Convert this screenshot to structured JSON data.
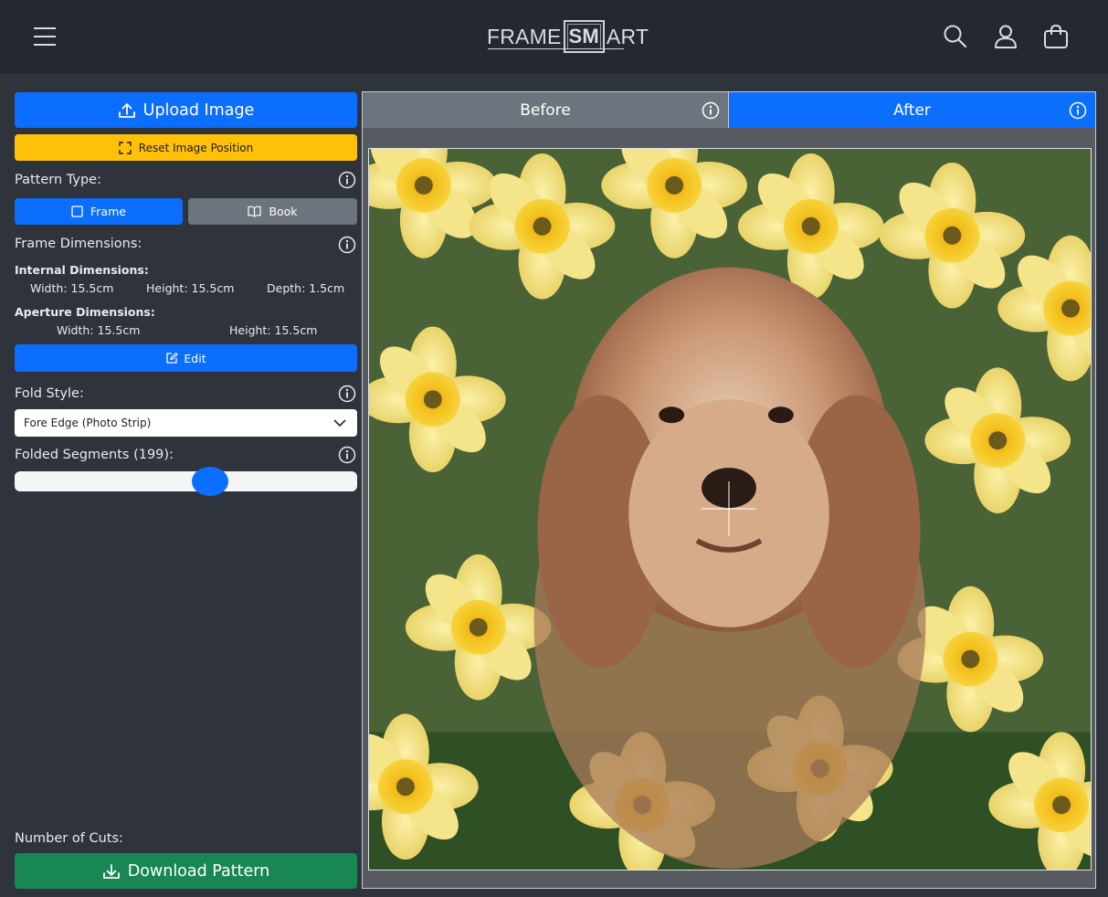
{
  "header": {
    "logo": {
      "left": "FRAME",
      "middle": "SM",
      "right": "ART"
    },
    "icons": [
      "menu-icon",
      "search-icon",
      "user-icon",
      "cart-icon"
    ]
  },
  "sidebar": {
    "upload_label": "Upload Image",
    "reset_label": "Reset Image Position",
    "pattern_type": {
      "label": "Pattern Type:",
      "options": [
        {
          "label": "Frame",
          "selected": true
        },
        {
          "label": "Book",
          "selected": false
        }
      ]
    },
    "frame_dimensions": {
      "label": "Frame Dimensions:",
      "internal": {
        "label": "Internal Dimensions:",
        "width": "Width: 15.5cm",
        "height": "Height: 15.5cm",
        "depth": "Depth: 1.5cm"
      },
      "aperture": {
        "label": "Aperture Dimensions:",
        "width": "Width: 15.5cm",
        "height": "Height: 15.5cm"
      },
      "edit_label": "Edit"
    },
    "fold_style": {
      "label": "Fold Style:",
      "value": "Fore Edge (Photo Strip)"
    },
    "folded_segments": {
      "label": "Folded Segments (199):",
      "value": 199,
      "fraction": 0.58
    },
    "cuts_label": "Number of Cuts:",
    "download_label": "Download Pattern"
  },
  "viewer": {
    "tabs": [
      {
        "label": "Before",
        "active": false
      },
      {
        "label": "After",
        "active": true
      }
    ]
  },
  "colors": {
    "primary": "#0b6efd",
    "warning": "#ffc107",
    "secondary": "#6c757d",
    "success": "#198754",
    "header_bg": "#25282e",
    "page_bg": "#2f333b"
  }
}
